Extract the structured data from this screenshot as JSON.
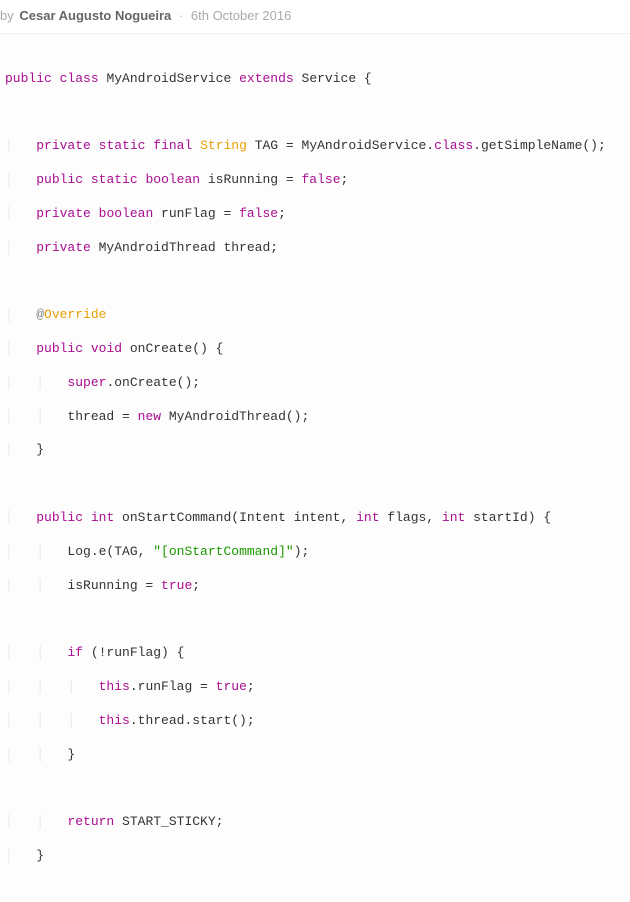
{
  "header": {
    "by": "by",
    "author": "Cesar Augusto Nogueira",
    "date": "6th October 2016"
  },
  "code": {
    "l1_public": "public",
    "l1_class": "class",
    "l1_name": "MyAndroidService",
    "l1_extends": "extends",
    "l1_super": "Service {",
    "l3_private": "private",
    "l3_static": "static",
    "l3_final": "final",
    "l3_String": "String",
    "l3_rest1": " TAG = MyAndroidService.",
    "l3_classkw": "class",
    "l3_rest2": ".getSimpleName();",
    "l4_public": "public",
    "l4_static": "static",
    "l4_boolean": "boolean",
    "l4_name": " isRunning = ",
    "l4_false": "false",
    "l4_semi": ";",
    "l5_private": "private",
    "l5_boolean": "boolean",
    "l5_name": " runFlag = ",
    "l5_false": "false",
    "l5_semi": ";",
    "l6_private": "private",
    "l6_rest": " MyAndroidThread thread;",
    "l8_at": "@",
    "l8_override": "Override",
    "l9_public": "public",
    "l9_void": "void",
    "l9_rest": " onCreate() {",
    "l10_super": "super",
    "l10_rest": ".onCreate();",
    "l11_a": "thread = ",
    "l11_new": "new",
    "l11_b": " MyAndroidThread();",
    "l12": "}",
    "l14_public": "public",
    "l14_int": "int",
    "l14_a": " onStartCommand(Intent intent, ",
    "l14_int2": "int",
    "l14_b": " flags, ",
    "l14_int3": "int",
    "l14_c": " startId) {",
    "l15_a": "Log.e(TAG, ",
    "l15_str": "\"[onStartCommand]\"",
    "l15_b": ");",
    "l16_a": "isRunning = ",
    "l16_true": "true",
    "l16_b": ";",
    "l18_if": "if",
    "l18_rest": " (!runFlag) {",
    "l19_this": "this",
    "l19_a": ".runFlag = ",
    "l19_true": "true",
    "l19_b": ";",
    "l20_this": "this",
    "l20_a": ".thread.start();",
    "l21": "}",
    "l23_return": "return",
    "l23_a": " START_STICKY;",
    "l24": "}"
  }
}
